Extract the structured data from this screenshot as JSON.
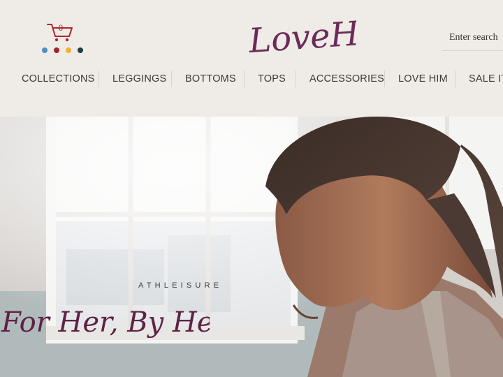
{
  "cart": {
    "count": "0",
    "color": "#b0272d"
  },
  "dots": [
    {
      "name": "blue",
      "color": "#4a8fc6"
    },
    {
      "name": "red",
      "color": "#a3232b"
    },
    {
      "name": "yellow",
      "color": "#ecb23a"
    },
    {
      "name": "dark-teal",
      "color": "#1c3f3f"
    }
  ],
  "brand": {
    "logo_text": "LoveHer",
    "color": "#6b2b58"
  },
  "search": {
    "placeholder": "Enter search"
  },
  "nav": {
    "items": [
      {
        "label": "COLLECTIONS"
      },
      {
        "label": "LEGGINGS"
      },
      {
        "label": "BOTTOMS"
      },
      {
        "label": "TOPS"
      },
      {
        "label": "ACCESSORIES"
      },
      {
        "label": "LOVE HIM"
      },
      {
        "label": "SALE ITE"
      }
    ]
  },
  "hero": {
    "eyebrow": "ATHLEISURE",
    "tagline": "For Her, By Her",
    "tagline_color": "#5e2147"
  }
}
